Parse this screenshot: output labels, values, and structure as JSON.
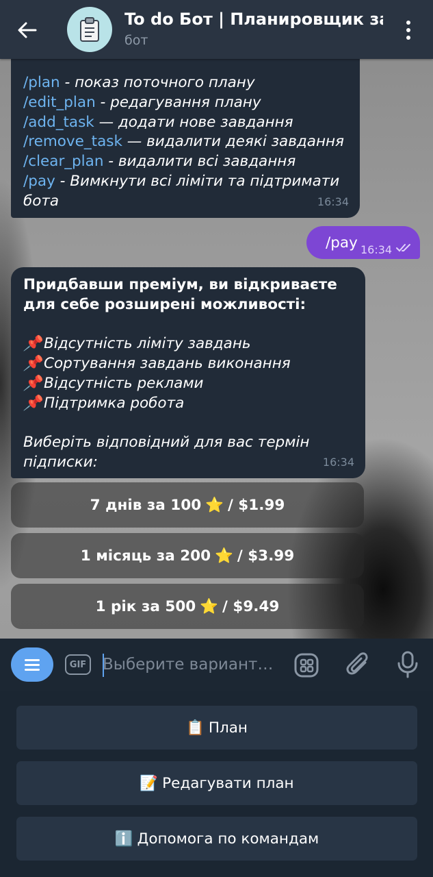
{
  "header": {
    "title": "To do Бот | Планировщик задач",
    "subtitle": "бот"
  },
  "messages": {
    "commands": {
      "lines": [
        {
          "cmd": "/plan",
          "desc": " - показ поточного плану"
        },
        {
          "cmd": "/edit_plan",
          "desc": " - редагування плану"
        },
        {
          "cmd": "/add_task",
          "desc": " — додати нове завдання"
        },
        {
          "cmd": "/remove_task",
          "desc": " — видалити деякі завдання"
        },
        {
          "cmd": "/clear_plan",
          "desc": " - видалити всі завдання"
        },
        {
          "cmd": "/pay",
          "desc": " - Вимкнути всі ліміти та підтримати"
        }
      ],
      "last_line": "бота",
      "time": "16:34"
    },
    "pay": {
      "text": "/pay",
      "time": "16:34"
    },
    "premium": {
      "intro": "Придбавши преміум, ви відкриваєте для себе розширені можливості:",
      "features": [
        "Відсутність ліміту завдань",
        "Сортування завдань виконання",
        "Відсутність реклами",
        "Підтримка робота"
      ],
      "choose": "Виберіть відповідний для вас термін підписки:",
      "time": "16:34"
    }
  },
  "inline_keyboard": [
    {
      "before": "7 днів за 100",
      "after": "/ $1.99"
    },
    {
      "before": "1 місяць за 200",
      "after": "/ $3.99"
    },
    {
      "before": "1 рік за 500",
      "after": "/ $9.49"
    }
  ],
  "input": {
    "gif_label": "GIF",
    "placeholder": "Выберите вариант…"
  },
  "reply_keyboard": [
    {
      "label": "План",
      "icon": "clipboard-icon"
    },
    {
      "label": "Редагувати план",
      "icon": "memo-icon"
    },
    {
      "label": "Допомога по командам",
      "icon": "info-icon"
    }
  ],
  "colors": {
    "accent": "#5fa3f0",
    "outgoing_bubble": "#7d46d4",
    "incoming_bubble": "#212b38",
    "link": "#6eb4f0"
  }
}
